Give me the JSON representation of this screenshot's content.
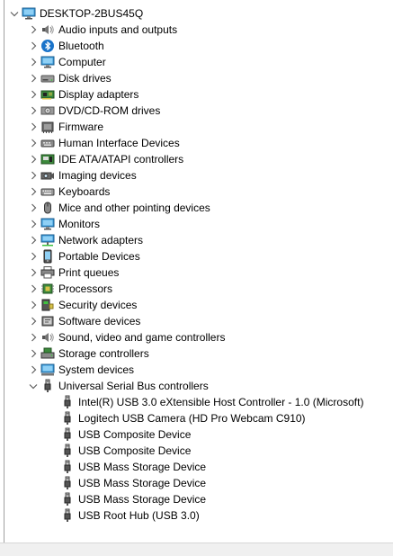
{
  "root": {
    "label": "DESKTOP-2BUS45Q",
    "icon": "computer-icon"
  },
  "categories": [
    {
      "label": "Audio inputs and outputs",
      "icon": "speaker-icon",
      "expanded": false
    },
    {
      "label": "Bluetooth",
      "icon": "bluetooth-icon",
      "expanded": false
    },
    {
      "label": "Computer",
      "icon": "monitor-icon",
      "expanded": false
    },
    {
      "label": "Disk drives",
      "icon": "disk-drive-icon",
      "expanded": false
    },
    {
      "label": "Display adapters",
      "icon": "display-adapter-icon",
      "expanded": false
    },
    {
      "label": "DVD/CD-ROM drives",
      "icon": "dvd-drive-icon",
      "expanded": false
    },
    {
      "label": "Firmware",
      "icon": "firmware-icon",
      "expanded": false
    },
    {
      "label": "Human Interface Devices",
      "icon": "hid-icon",
      "expanded": false
    },
    {
      "label": "IDE ATA/ATAPI controllers",
      "icon": "ide-controller-icon",
      "expanded": false
    },
    {
      "label": "Imaging devices",
      "icon": "camera-icon",
      "expanded": false
    },
    {
      "label": "Keyboards",
      "icon": "keyboard-icon",
      "expanded": false
    },
    {
      "label": "Mice and other pointing devices",
      "icon": "mouse-icon",
      "expanded": false
    },
    {
      "label": "Monitors",
      "icon": "monitor-icon",
      "expanded": false
    },
    {
      "label": "Network adapters",
      "icon": "network-adapter-icon",
      "expanded": false
    },
    {
      "label": "Portable Devices",
      "icon": "portable-device-icon",
      "expanded": false
    },
    {
      "label": "Print queues",
      "icon": "printer-icon",
      "expanded": false
    },
    {
      "label": "Processors",
      "icon": "processor-icon",
      "expanded": false
    },
    {
      "label": "Security devices",
      "icon": "security-device-icon",
      "expanded": false
    },
    {
      "label": "Software devices",
      "icon": "software-device-icon",
      "expanded": false
    },
    {
      "label": "Sound, video and game controllers",
      "icon": "speaker-icon",
      "expanded": false
    },
    {
      "label": "Storage controllers",
      "icon": "storage-controller-icon",
      "expanded": false
    },
    {
      "label": "System devices",
      "icon": "system-device-icon",
      "expanded": false
    },
    {
      "label": "Universal Serial Bus controllers",
      "icon": "usb-plug-icon",
      "expanded": true
    }
  ],
  "usb_children": [
    {
      "label": "Intel(R) USB 3.0 eXtensible Host Controller - 1.0 (Microsoft)",
      "icon": "usb-plug-icon"
    },
    {
      "label": "Logitech USB Camera (HD Pro Webcam C910)",
      "icon": "usb-plug-icon"
    },
    {
      "label": "USB Composite Device",
      "icon": "usb-plug-icon"
    },
    {
      "label": "USB Composite Device",
      "icon": "usb-plug-icon"
    },
    {
      "label": "USB Mass Storage Device",
      "icon": "usb-plug-icon"
    },
    {
      "label": "USB Mass Storage Device",
      "icon": "usb-plug-icon"
    },
    {
      "label": "USB Mass Storage Device",
      "icon": "usb-plug-icon"
    },
    {
      "label": "USB Root Hub (USB 3.0)",
      "icon": "usb-plug-icon"
    }
  ],
  "colors": {
    "chevron": "#606060",
    "border": "#a0a0a0",
    "statusbar": "#f0f0f0",
    "monitor_blue": "#3a9ad9",
    "bluetooth_blue": "#1a73c9"
  }
}
